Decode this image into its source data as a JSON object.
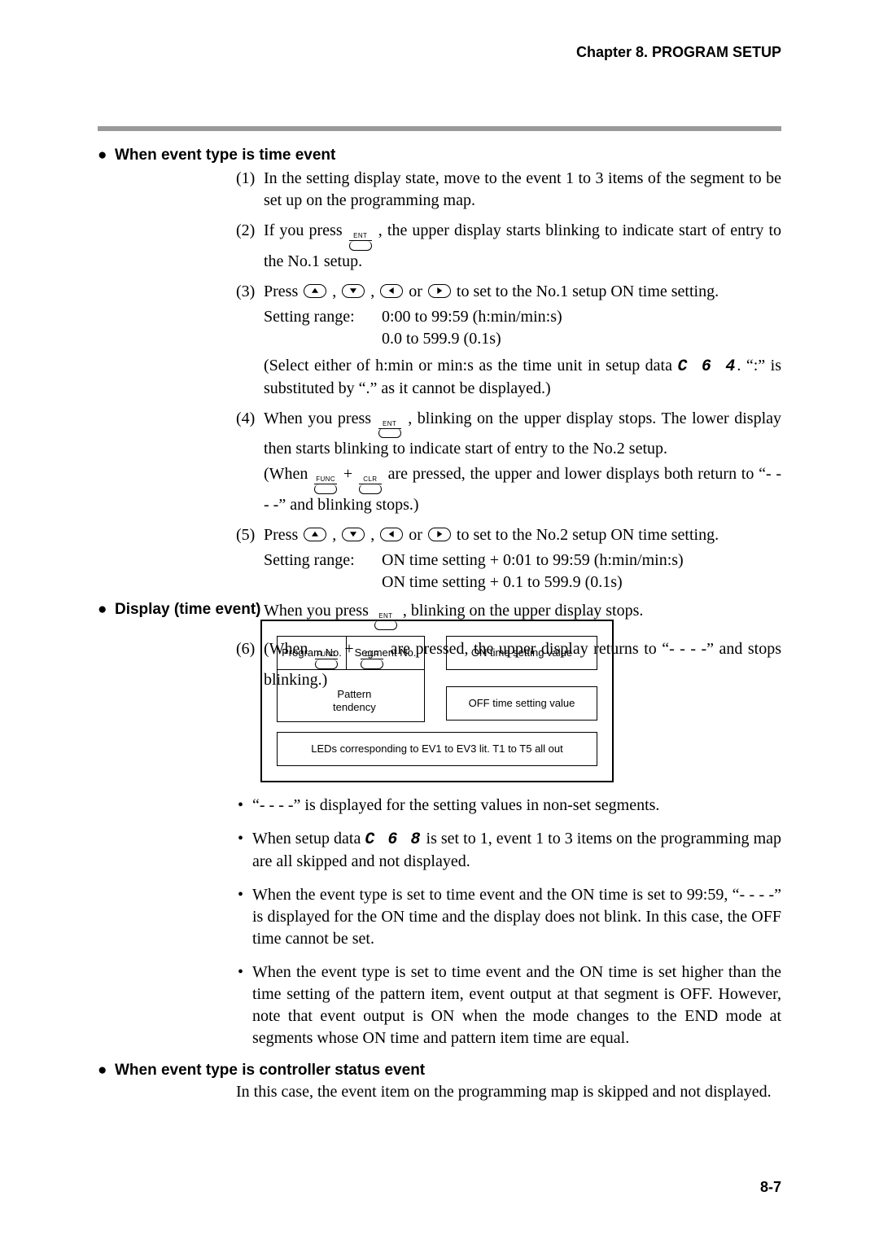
{
  "header": {
    "chapter": "Chapter 8. PROGRAM SETUP"
  },
  "sections": {
    "s1": "When event type is time event",
    "s2": "Display (time event)",
    "s3": "When event type is controller status event"
  },
  "items": {
    "i1n": "(1)",
    "i1": "In the setting display state, move to the event 1 to 3 items of the segment to be set up on the programming map.",
    "i2n": "(2)",
    "i2a": "If you press ",
    "i2b": ", the upper display starts blinking to indicate start of entry to the No.1 setup.",
    "i3n": "(3)",
    "i3a": "Press ",
    "i3b": " to set to the No.1 setup ON time setting.",
    "sr_label": "Setting range:",
    "sr1a": "0:00 to 99:59 (h:min/min:s)",
    "sr1b": "0.0 to 599.9 (0.1s)",
    "i3_note_a": "(Select either of h:min or min:s as the time unit in setup data ",
    "seg_c64": "C 6 4",
    "i3_note_b": ". “:” is substituted by “.” as it cannot be displayed.)",
    "i4n": "(4)",
    "i4a": "When you press ",
    "i4b": ", blinking on the upper display stops. The lower display then starts blinking to indicate start of entry to the No.2 setup.",
    "i4_note_a": "(When ",
    "i4_note_b": " are pressed, the upper and lower displays both return to “- - - -” and blinking stops.)",
    "i5n": "(5)",
    "i5a": "Press ",
    "i5b": " to set to the No.2 setup ON time setting.",
    "sr2a": "ON time setting + 0:01 to 99:59 (h:min/min:s)",
    "sr2b": "ON time setting + 0.1 to 599.9 (0.1s)",
    "i5_tail_a": "When you press ",
    "i5_tail_b": ", blinking on the upper display stops.",
    "i6n": "(6)",
    "i6a": "(When ",
    "i6b": " are pressed, the upper display returns to “- - - -” and stops blinking.)"
  },
  "keys": {
    "ent": "ENT",
    "func": "FUNC",
    "clr": "CLR"
  },
  "diagram": {
    "prog": "Program No.",
    "seg": "Segment No.",
    "pattern": "Pattern\ntendency",
    "on": "ON time setting value",
    "off": "OFF time setting value",
    "leds": "LEDs corresponding to EV1 to EV3 lit. T1 to T5 all out"
  },
  "bullets": {
    "b1": "“- - - -” is displayed for the setting values in non-set segments.",
    "b2a": "When setup data ",
    "seg_c68": "C 6 8",
    "b2b": " is set to 1, event 1 to 3 items on the programming map are all skipped and not displayed.",
    "b3": "When the event type is set to time event and the ON time is set to 99:59, “- - - -” is displayed for the ON time and the display does not blink. In this case, the OFF time cannot be set.",
    "b4": "When the event type is set to time event and the ON time is set higher than the time setting of the pattern item, event output at that segment is OFF. However, note that event output is ON when the mode changes to the END mode at segments whose ON time and pattern item time are equal."
  },
  "s3_body": "In this case, the event item on the programming map is skipped and not displayed.",
  "footer": {
    "page": "8-7"
  }
}
